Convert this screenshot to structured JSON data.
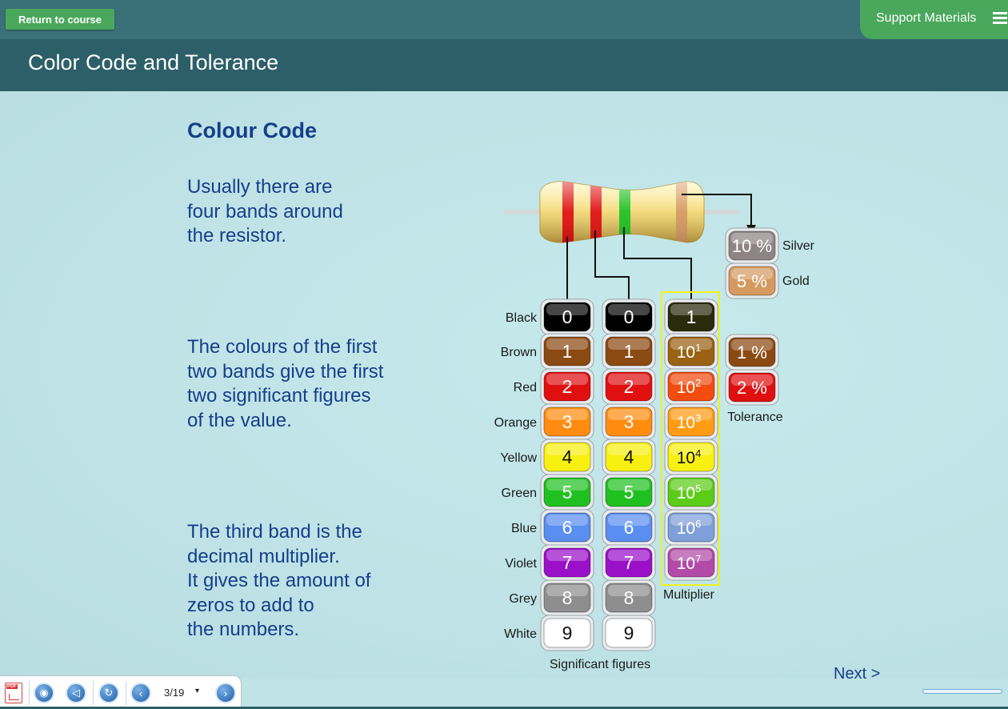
{
  "header": {
    "return_label": "Return to course",
    "support_label": "Support Materials",
    "page_title": "Color Code and Tolerance"
  },
  "main": {
    "heading": "Colour Code",
    "para1": [
      "Usually there are",
      "four bands around",
      "the resistor."
    ],
    "para2": [
      "The colours of the first",
      "two bands give the first",
      "two significant figures",
      "of the value."
    ],
    "para3": [
      "The third band is the",
      "decimal multiplier.",
      "It gives the amount of",
      "zeros to add to",
      "the numbers."
    ]
  },
  "diagram": {
    "color_names": [
      "Black",
      "Brown",
      "Red",
      "Orange",
      "Yellow",
      "Green",
      "Blue",
      "Violet",
      "Grey",
      "White"
    ],
    "digits": [
      "0",
      "1",
      "2",
      "3",
      "4",
      "5",
      "6",
      "7",
      "8",
      "9"
    ],
    "multiplier_base": "10",
    "multiplier_first": "1",
    "multiplier_exponents": [
      "1",
      "2",
      "3",
      "4",
      "5",
      "6",
      "7"
    ],
    "multiplier_label": "Multiplier",
    "significant_label": "Significant figures",
    "tolerance_label": "Tolerance",
    "tolerance_values": [
      {
        "name": "Silver",
        "value": "10 %"
      },
      {
        "name": "Gold",
        "value": "5 %"
      },
      {
        "name": "Brown",
        "value": "1 %"
      },
      {
        "name": "Red",
        "value": "2 %"
      }
    ],
    "colors": {
      "black": "#000000",
      "brown": "#8b4a12",
      "red": "#e01010",
      "orange": "#ff8c10",
      "yellow": "#f8f010",
      "green": "#20c020",
      "blue": "#5a8ef0",
      "violet": "#9a10c8",
      "grey": "#8e8e8e",
      "white": "#ffffff",
      "silver": "#8f8484",
      "gold": "#d59a60",
      "highlight": "#f2f21a"
    },
    "resistor_band_colors": [
      "#e01010",
      "#e01010",
      "#20c020",
      "#d59a60"
    ]
  },
  "toolbar": {
    "page_indicator": "3/19",
    "page_caret": "▾"
  },
  "nav": {
    "next_label": "Next >"
  }
}
